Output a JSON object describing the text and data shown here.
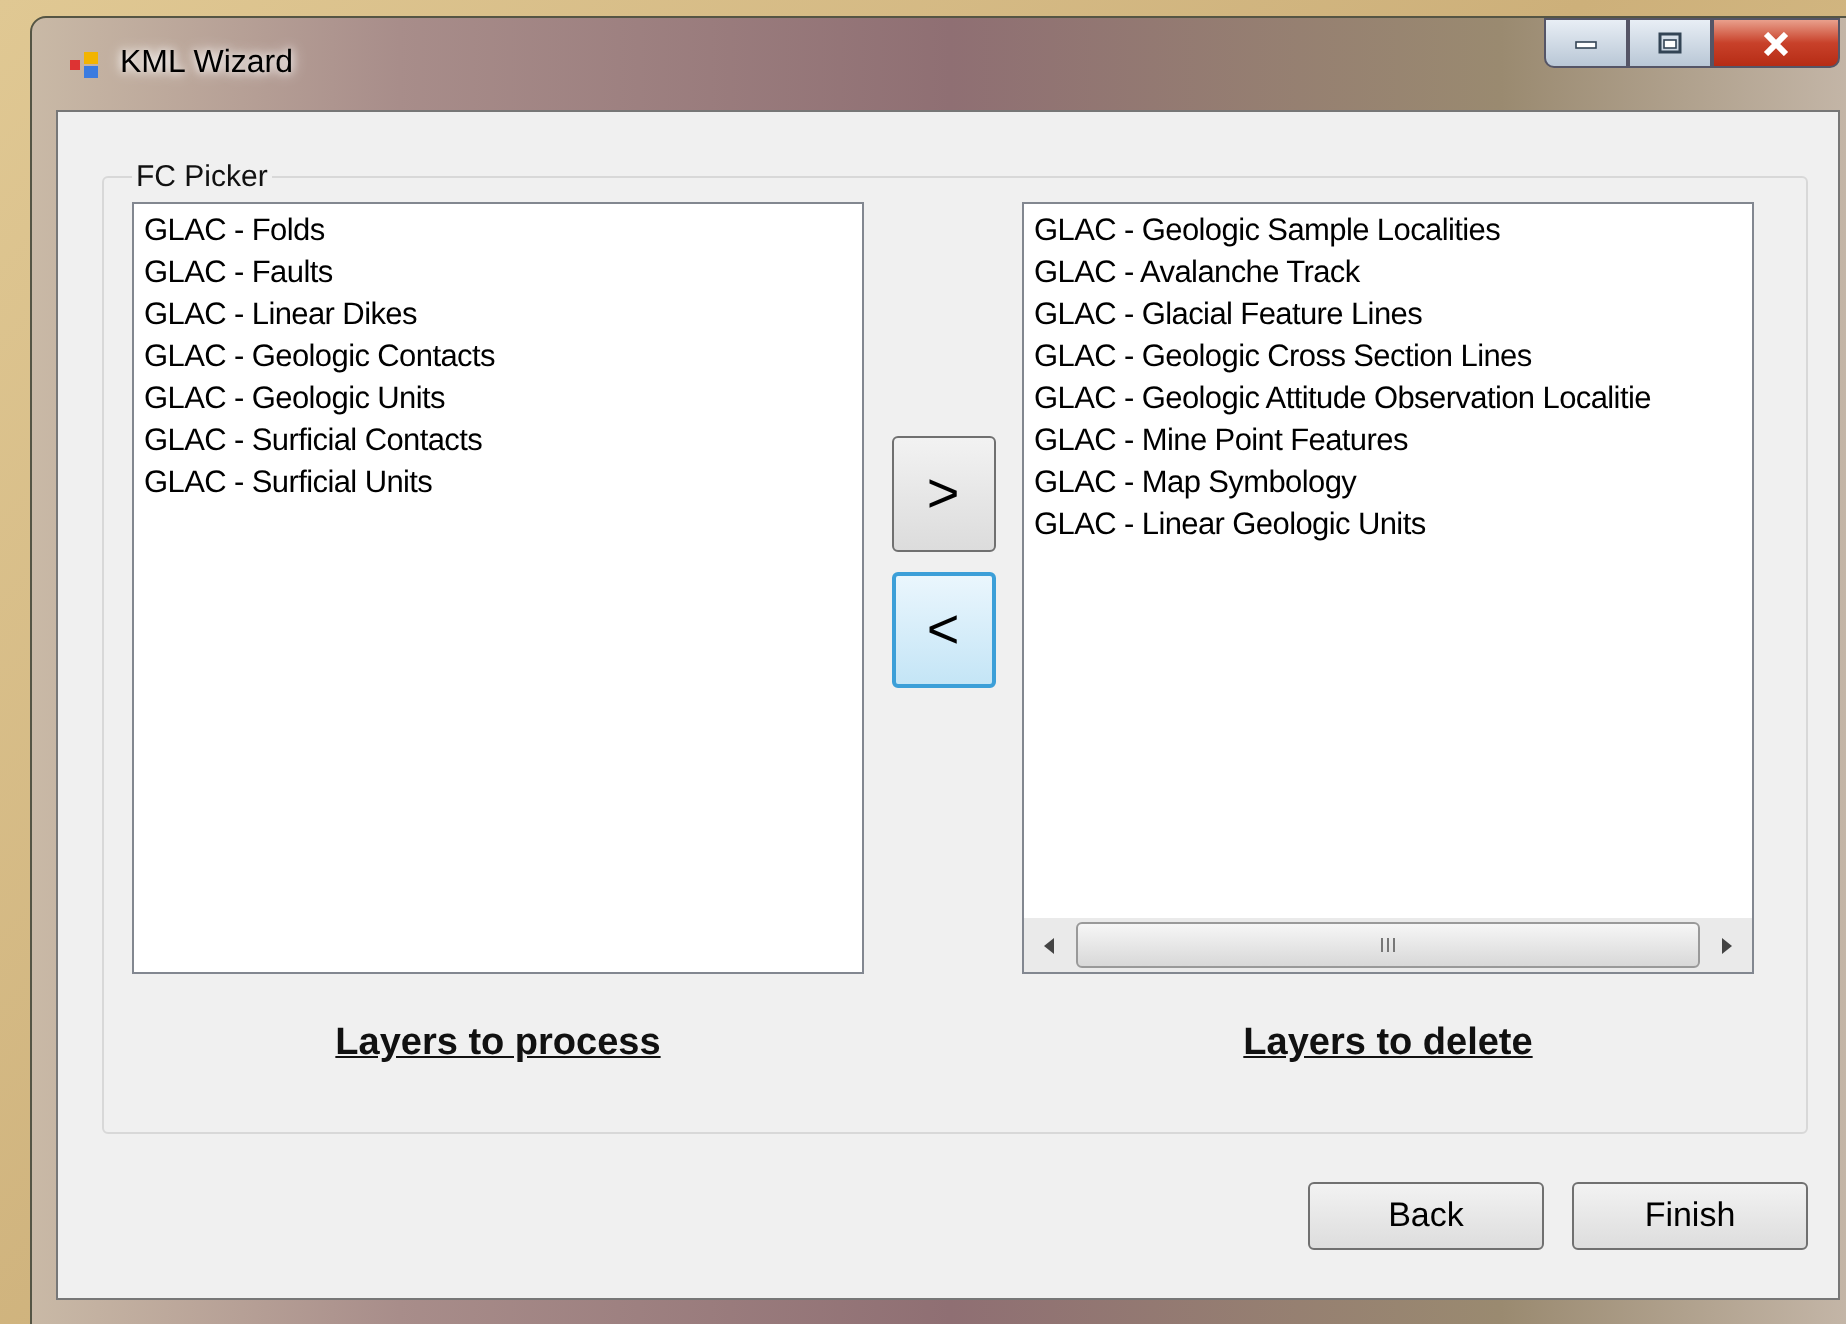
{
  "window": {
    "title": "KML Wizard"
  },
  "group": {
    "title": "FC Picker"
  },
  "left_list": {
    "items": [
      "GLAC - Folds",
      "GLAC - Faults",
      "GLAC - Linear Dikes",
      "GLAC - Geologic Contacts",
      "GLAC - Geologic Units",
      "GLAC - Surficial Contacts",
      "GLAC - Surficial Units"
    ],
    "caption": "Layers to process"
  },
  "transfer_buttons": [
    {
      "label": ">",
      "focused": false
    },
    {
      "label": "<",
      "focused": true
    }
  ],
  "right_list": {
    "items": [
      "GLAC - Geologic Sample Localities",
      "GLAC - Avalanche Track",
      "GLAC - Glacial Feature Lines",
      "GLAC - Geologic Cross Section Lines",
      "GLAC - Geologic Attitude Observation Localitie",
      "GLAC - Mine Point Features",
      "GLAC - Map Symbology",
      "GLAC - Linear Geologic Units"
    ],
    "caption": "Layers to delete"
  },
  "buttons": [
    "Back",
    "Finish"
  ]
}
